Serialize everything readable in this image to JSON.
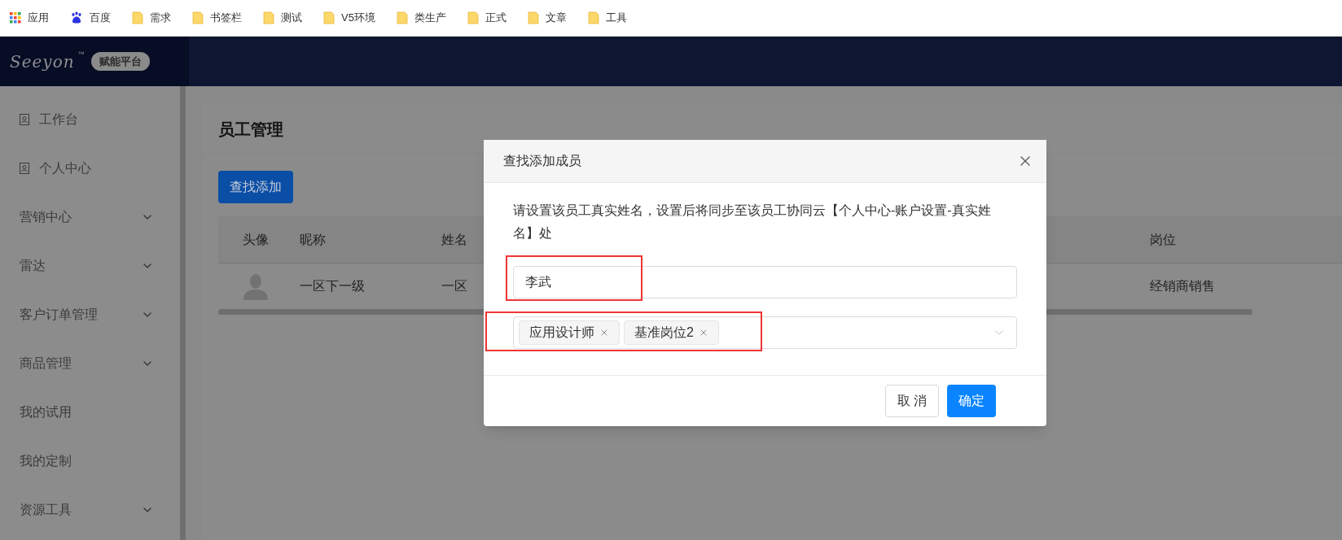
{
  "bookmarks": [
    {
      "kind": "apps",
      "label": "应用"
    },
    {
      "kind": "baidu",
      "label": "百度"
    },
    {
      "kind": "folder",
      "label": "需求"
    },
    {
      "kind": "folder",
      "label": "书签栏"
    },
    {
      "kind": "folder",
      "label": "测试"
    },
    {
      "kind": "folder",
      "label": "V5环境"
    },
    {
      "kind": "folder",
      "label": "类生产"
    },
    {
      "kind": "folder",
      "label": "正式"
    },
    {
      "kind": "folder",
      "label": "文章"
    },
    {
      "kind": "folder",
      "label": "工具"
    }
  ],
  "header": {
    "logo": "Seeyon",
    "trademark": "™",
    "badge": "赋能平台"
  },
  "sidebar": {
    "items": [
      {
        "label": "工作台",
        "kind": "page"
      },
      {
        "label": "个人中心",
        "kind": "page"
      },
      {
        "label": "营销中心",
        "kind": "group",
        "expanded": false
      },
      {
        "label": "雷达",
        "kind": "group",
        "expanded": false
      },
      {
        "label": "客户订单管理",
        "kind": "group",
        "expanded": false
      },
      {
        "label": "商品管理",
        "kind": "group",
        "expanded": false
      },
      {
        "label": "我的试用",
        "kind": "plain"
      },
      {
        "label": "我的定制",
        "kind": "plain"
      },
      {
        "label": "资源工具",
        "kind": "group",
        "expanded": false
      }
    ]
  },
  "page": {
    "title": "员工管理",
    "add_button": "查找添加",
    "table": {
      "columns": [
        "头像",
        "昵称",
        "姓名",
        "岗位"
      ],
      "rows": [
        {
          "nickname": "一区下一级",
          "name": "一区",
          "position": "经销商销售"
        }
      ]
    }
  },
  "dialog": {
    "title": "查找添加成员",
    "description": "请设置该员工真实姓名，设置后将同步至该员工协同云【个人中心-账户设置-真实姓名】处",
    "name_field": {
      "value": "李武",
      "highlighted": true
    },
    "positions_field": {
      "tags": [
        "应用设计师",
        "基准岗位2"
      ],
      "highlighted": true
    },
    "buttons": [
      {
        "label": "取 消",
        "kind": "secondary"
      },
      {
        "label": "确定",
        "kind": "primary"
      }
    ]
  }
}
